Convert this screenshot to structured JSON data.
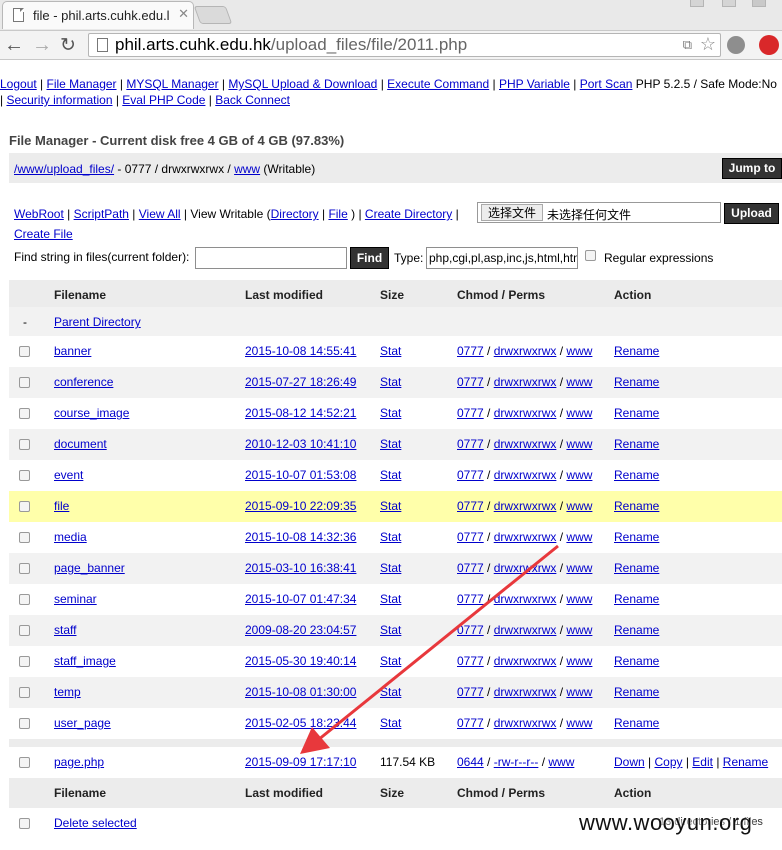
{
  "browser": {
    "tab_title": "file - phil.arts.cuhk.edu.l",
    "url_host": "phil.arts.cuhk.edu.hk",
    "url_path": "/upload_files/file/2011.php",
    "colors": {
      "accent_red": "#e8383c",
      "highlight_row": "#ffffaa"
    }
  },
  "menu": {
    "line1": [
      "Logout",
      "File Manager",
      "MYSQL Manager",
      "MySQL Upload & Download",
      "Execute Command",
      "PHP Variable",
      "Port Scan"
    ],
    "line1_suffix": "PHP 5.2.5 / Safe Mode:No",
    "line2": [
      "Security information",
      "Eval PHP Code",
      "Back Connect"
    ]
  },
  "fm": {
    "title": "File Manager - Current disk free 4 GB of 4 GB (97.83%)",
    "path_link": "/www/upload_files/",
    "path_perm": " - 0777 / drwxrwxrwx / ",
    "path_owner": "www",
    "path_state": " (Writable)",
    "jump_label": "Jump to",
    "tools": [
      "WebRoot",
      "ScriptPath",
      "View All"
    ],
    "view_writable": "View Writable (",
    "dir_link": "Directory",
    "file_link": "File",
    "create_dir": "Create Directory",
    "create_file": "Create File",
    "choose_label": "选择文件",
    "nofile_label": "未选择任何文件",
    "upload_label": "Upload",
    "find_label": "Find string in files(current folder):",
    "find_value": "",
    "find_button": "Find",
    "type_label": "Type:",
    "type_value": "php,cgi,pl,asp,inc,js,html,htm",
    "regex_label": "Regular expressions"
  },
  "columns": [
    "Filename",
    "Last modified",
    "Size",
    "Chmod / Perms",
    "Action"
  ],
  "parent_dash": "-",
  "parent_label": "Parent Directory",
  "dirs": [
    {
      "name": "banner",
      "modified": "2015-10-08 14:55:41"
    },
    {
      "name": "conference",
      "modified": "2015-07-27 18:26:49"
    },
    {
      "name": "course_image",
      "modified": "2015-08-12 14:52:21"
    },
    {
      "name": "document",
      "modified": "2010-12-03 10:41:10"
    },
    {
      "name": "event",
      "modified": "2015-10-07 01:53:08"
    },
    {
      "name": "file",
      "modified": "2015-09-10 22:09:35"
    },
    {
      "name": "media",
      "modified": "2015-10-08 14:32:36"
    },
    {
      "name": "page_banner",
      "modified": "2015-03-10 16:38:41"
    },
    {
      "name": "seminar",
      "modified": "2015-10-07 01:47:34"
    },
    {
      "name": "staff",
      "modified": "2009-08-20 23:04:57"
    },
    {
      "name": "staff_image",
      "modified": "2015-05-30 19:40:14"
    },
    {
      "name": "temp",
      "modified": "2015-10-08 01:30:00"
    },
    {
      "name": "user_page",
      "modified": "2015-02-05 18:23:44"
    }
  ],
  "dir_labels": {
    "stat": "Stat",
    "perm": "0777",
    "perms": "drwxrwxrwx",
    "owner": "www",
    "rename": "Rename"
  },
  "file_row": {
    "name": "page.php",
    "modified": "2015-09-09 17:17:10",
    "size": "117.54 KB",
    "perm": "0644",
    "perms": "-rw-r--r--",
    "owner": "www",
    "actions": [
      "Down",
      "Copy",
      "Edit",
      "Rename"
    ]
  },
  "footer": {
    "delete_label": "Delete selected",
    "summary": "13 directories / 1 files"
  },
  "watermark": "www.wooyun.org"
}
